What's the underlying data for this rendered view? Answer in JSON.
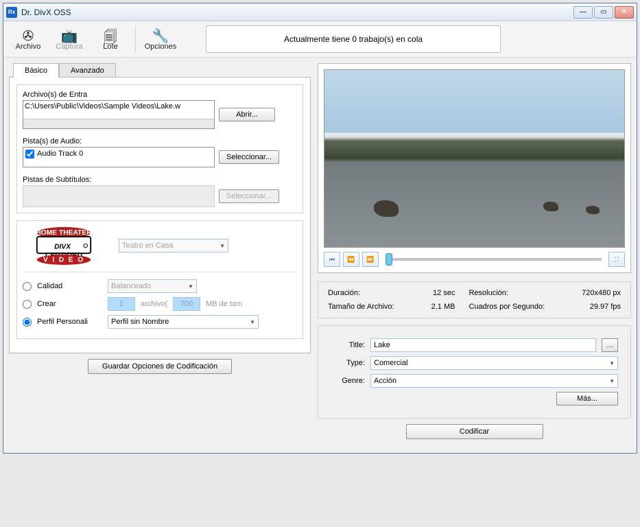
{
  "window": {
    "title": "Dr. DivX OSS"
  },
  "toolbar": {
    "archivo": "Archivo",
    "captura": "Captura",
    "lote": "Lote",
    "opciones": "Opciones",
    "queue_status": "Actualmente tiene 0 trabajo(s) en cola"
  },
  "tabs": {
    "basic": "Básico",
    "advanced": "Avanzado"
  },
  "input": {
    "files_label": "Archivo(s) de Entra",
    "file_path": "C:\\Users\\Public\\Videos\\Sample Videos\\Lake.w",
    "open_btn": "Abrir...",
    "audio_label": "Pista(s) de Audio:",
    "audio_track": "Audio Track 0",
    "select_btn": "Seleccionar...",
    "subtitle_label": "Pistas de Subtítulos:"
  },
  "profile": {
    "divx_cert": "Teatro en Casa",
    "quality_label": "Calidad",
    "quality_value": "Balanceado",
    "create_label": "Crear",
    "create_count": "1",
    "create_file": "archivo(",
    "create_size": "700",
    "create_unit": "MB de tam",
    "custom_label": "Perfil Personali",
    "custom_value": "Perfil sin Nombre"
  },
  "buttons": {
    "save_opts": "Guardar Opciones de Codificación",
    "encode": "Codificar",
    "more": "Más..."
  },
  "info": {
    "duration_k": "Duración:",
    "duration_v": "12 sec",
    "resolution_k": "Resolución:",
    "resolution_v": "720x480 px",
    "filesize_k": "Tamaño de Archivo:",
    "filesize_v": "2.1 MB",
    "fps_k": "Cuadros por Segundo:",
    "fps_v": "29.97 fps"
  },
  "meta": {
    "title_label": "Title:",
    "title_value": "Lake",
    "type_label": "Type:",
    "type_value": "Comercial",
    "genre_label": "Genre:",
    "genre_value": "Acción"
  }
}
